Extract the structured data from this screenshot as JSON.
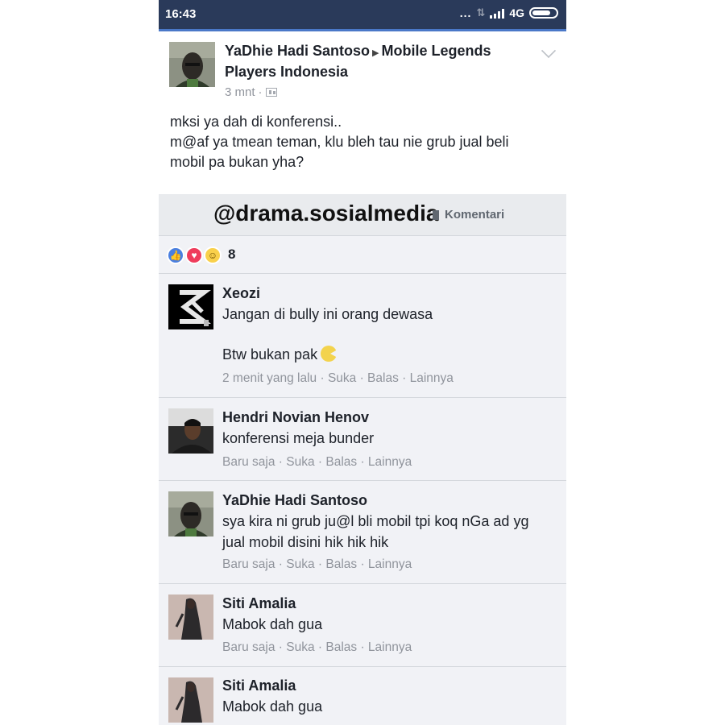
{
  "status_bar": {
    "time": "16:43",
    "dots": "...",
    "network": "4G"
  },
  "post": {
    "author": "YaDhie Hadi Santoso",
    "group": "Mobile Legends Players Indonesia",
    "time": "3 mnt",
    "text_lines": [
      "mksi ya dah di konferensi..",
      "m@af ya tmean teman, klu bleh tau nie grub jual beli",
      "mobil pa bukan yha?"
    ]
  },
  "action_bar": {
    "watermark": "@drama.sosialmedia",
    "comment_label": "Komentari"
  },
  "reactions": {
    "count": "8"
  },
  "comments": [
    {
      "name": "Xeozi",
      "text_lines": [
        "Jangan di bully ini orang dewasa",
        "",
        "Btw bukan pak"
      ],
      "meta": "2 menit yang lalu · Suka · Balas · Lainnya"
    },
    {
      "name": "Hendri Novian Henov",
      "text_lines": [
        "konferensi meja bunder"
      ],
      "meta": "Baru saja · Suka · Balas · Lainnya"
    },
    {
      "name": "YaDhie Hadi Santoso",
      "text_lines": [
        "sya kira ni grub ju@l bli mobil tpi koq nGa ad yg",
        "jual mobil disini hik hik hik"
      ],
      "meta": "Baru saja · Suka · Balas · Lainnya"
    },
    {
      "name": "Siti Amalia",
      "text_lines": [
        "Mabok dah gua"
      ],
      "meta": "Baru saja · Suka · Balas · Lainnya"
    },
    {
      "name": "Siti Amalia",
      "text_lines": [
        "Mabok dah gua"
      ],
      "meta": ""
    }
  ],
  "colors": {
    "status_bar": "#2a3a5a",
    "accent": "#4a78c8",
    "like": "#4a7fe0",
    "love": "#ef3c5c",
    "haha": "#f9d04b"
  },
  "icons": [
    "signal-icon",
    "battery-icon",
    "chevron-down-icon",
    "group-privacy-icon",
    "comment-icon",
    "like-reaction-icon",
    "love-reaction-icon",
    "haha-reaction-icon",
    "pacman-emoji-icon"
  ]
}
